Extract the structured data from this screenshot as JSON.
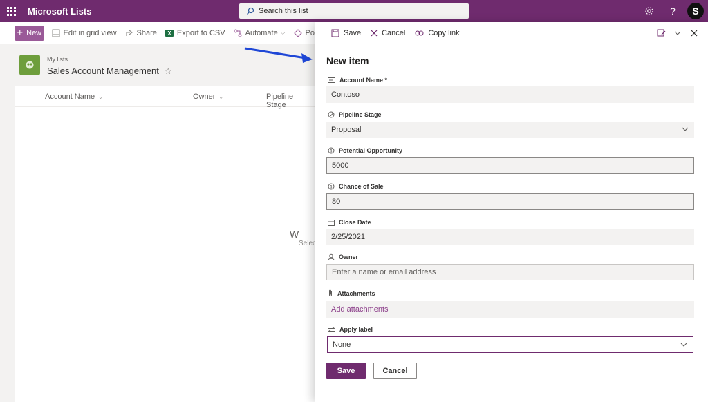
{
  "suite": {
    "app_title": "Microsoft Lists",
    "search_placeholder": "Search this list",
    "help_glyph": "?",
    "avatar_initial": "S"
  },
  "commandbar": {
    "new_label": "New",
    "edit_grid_label": "Edit in grid view",
    "share_label": "Share",
    "export_label": "Export to CSV",
    "automate_label": "Automate",
    "power_label": "Po"
  },
  "list": {
    "breadcrumb": "My lists",
    "title": "Sales Account Management",
    "columns": [
      "Account Name",
      "Owner",
      "Pipeline Stage"
    ],
    "empty_title": "W",
    "empty_sub": "Selec"
  },
  "panel": {
    "save_label": "Save",
    "cancel_label": "Cancel",
    "copy_link_label": "Copy link",
    "form_title": "New item",
    "fields": {
      "account_name": {
        "label": "Account Name *",
        "value": "Contoso"
      },
      "pipeline_stage": {
        "label": "Pipeline Stage",
        "value": "Proposal"
      },
      "potential_opportunity": {
        "label": "Potential Opportunity",
        "value": "5000"
      },
      "chance_of_sale": {
        "label": "Chance of Sale",
        "value": "80"
      },
      "close_date": {
        "label": "Close Date",
        "value": "2/25/2021"
      },
      "owner": {
        "label": "Owner",
        "placeholder": "Enter a name or email address"
      },
      "attachments": {
        "label": "Attachments",
        "link": "Add attachments"
      },
      "apply_label": {
        "label": "Apply label",
        "value": "None"
      }
    },
    "footer_save": "Save",
    "footer_cancel": "Cancel"
  },
  "colors": {
    "suite_bar": "#6f2b6e",
    "new_button": "#9a5a98",
    "accent": "#6f2b6e",
    "list_logo": "#6e9e3c",
    "annotation_arrow": "#1f47d6"
  },
  "icons": [
    "waffle-icon",
    "search-icon",
    "gear-icon",
    "help-icon",
    "grid-icon",
    "share-icon",
    "excel-icon",
    "automate-icon",
    "power-icon",
    "save-icon",
    "close-icon",
    "link-icon",
    "panel-edit-icon",
    "chevron-down-icon"
  ]
}
